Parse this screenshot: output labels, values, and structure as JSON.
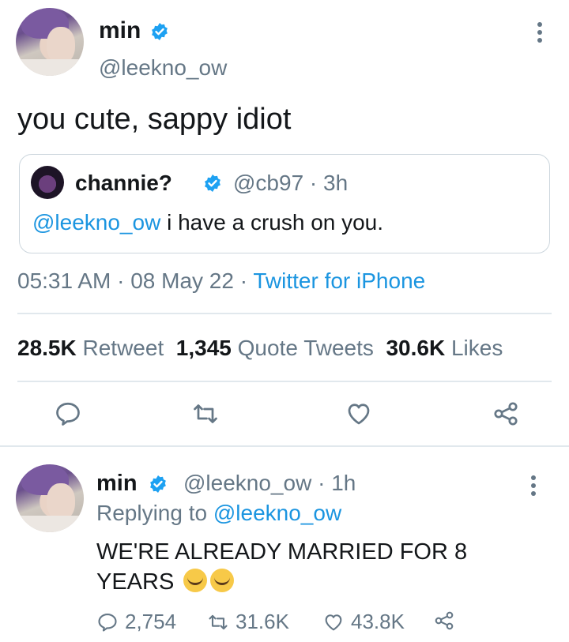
{
  "main_tweet": {
    "name": "min",
    "handle": "@leekno_ow",
    "text": "you cute, sappy idiot",
    "timestamp": "05:31 AM",
    "date": "08 May 22",
    "source": "Twitter for iPhone",
    "separator": "·"
  },
  "quoted_tweet": {
    "name": "channie?",
    "handle": "@cb97",
    "time": "3h",
    "mention": "@leekno_ow",
    "text": " i have a crush on you."
  },
  "stats": {
    "retweets_count": "28.5K",
    "retweets_label": "Retweet",
    "quotes_count": "1,345",
    "quotes_label": "Quote Tweets",
    "likes_count": "30.6K",
    "likes_label": "Likes"
  },
  "reply": {
    "name": "min",
    "handle": "@leekno_ow",
    "time": "1h",
    "replying_prefix": "Replying to",
    "replying_to": "@leekno_ow",
    "text": "WE'RE ALREADY MARRIED FOR 8 YEARS",
    "emojis": [
      "loudly-crying-face",
      "loudly-crying-face"
    ],
    "reply_count": "2,754",
    "retweet_count": "31.6K",
    "like_count": "43.8K"
  },
  "colors": {
    "text": "#14171a",
    "secondary": "#657786",
    "link": "#1b95e0",
    "verified": "#1da1f2",
    "divider": "#e1e8ed"
  },
  "icons": [
    "verified-badge-icon",
    "more-icon",
    "reply-icon",
    "retweet-icon",
    "like-icon",
    "share-icon"
  ]
}
